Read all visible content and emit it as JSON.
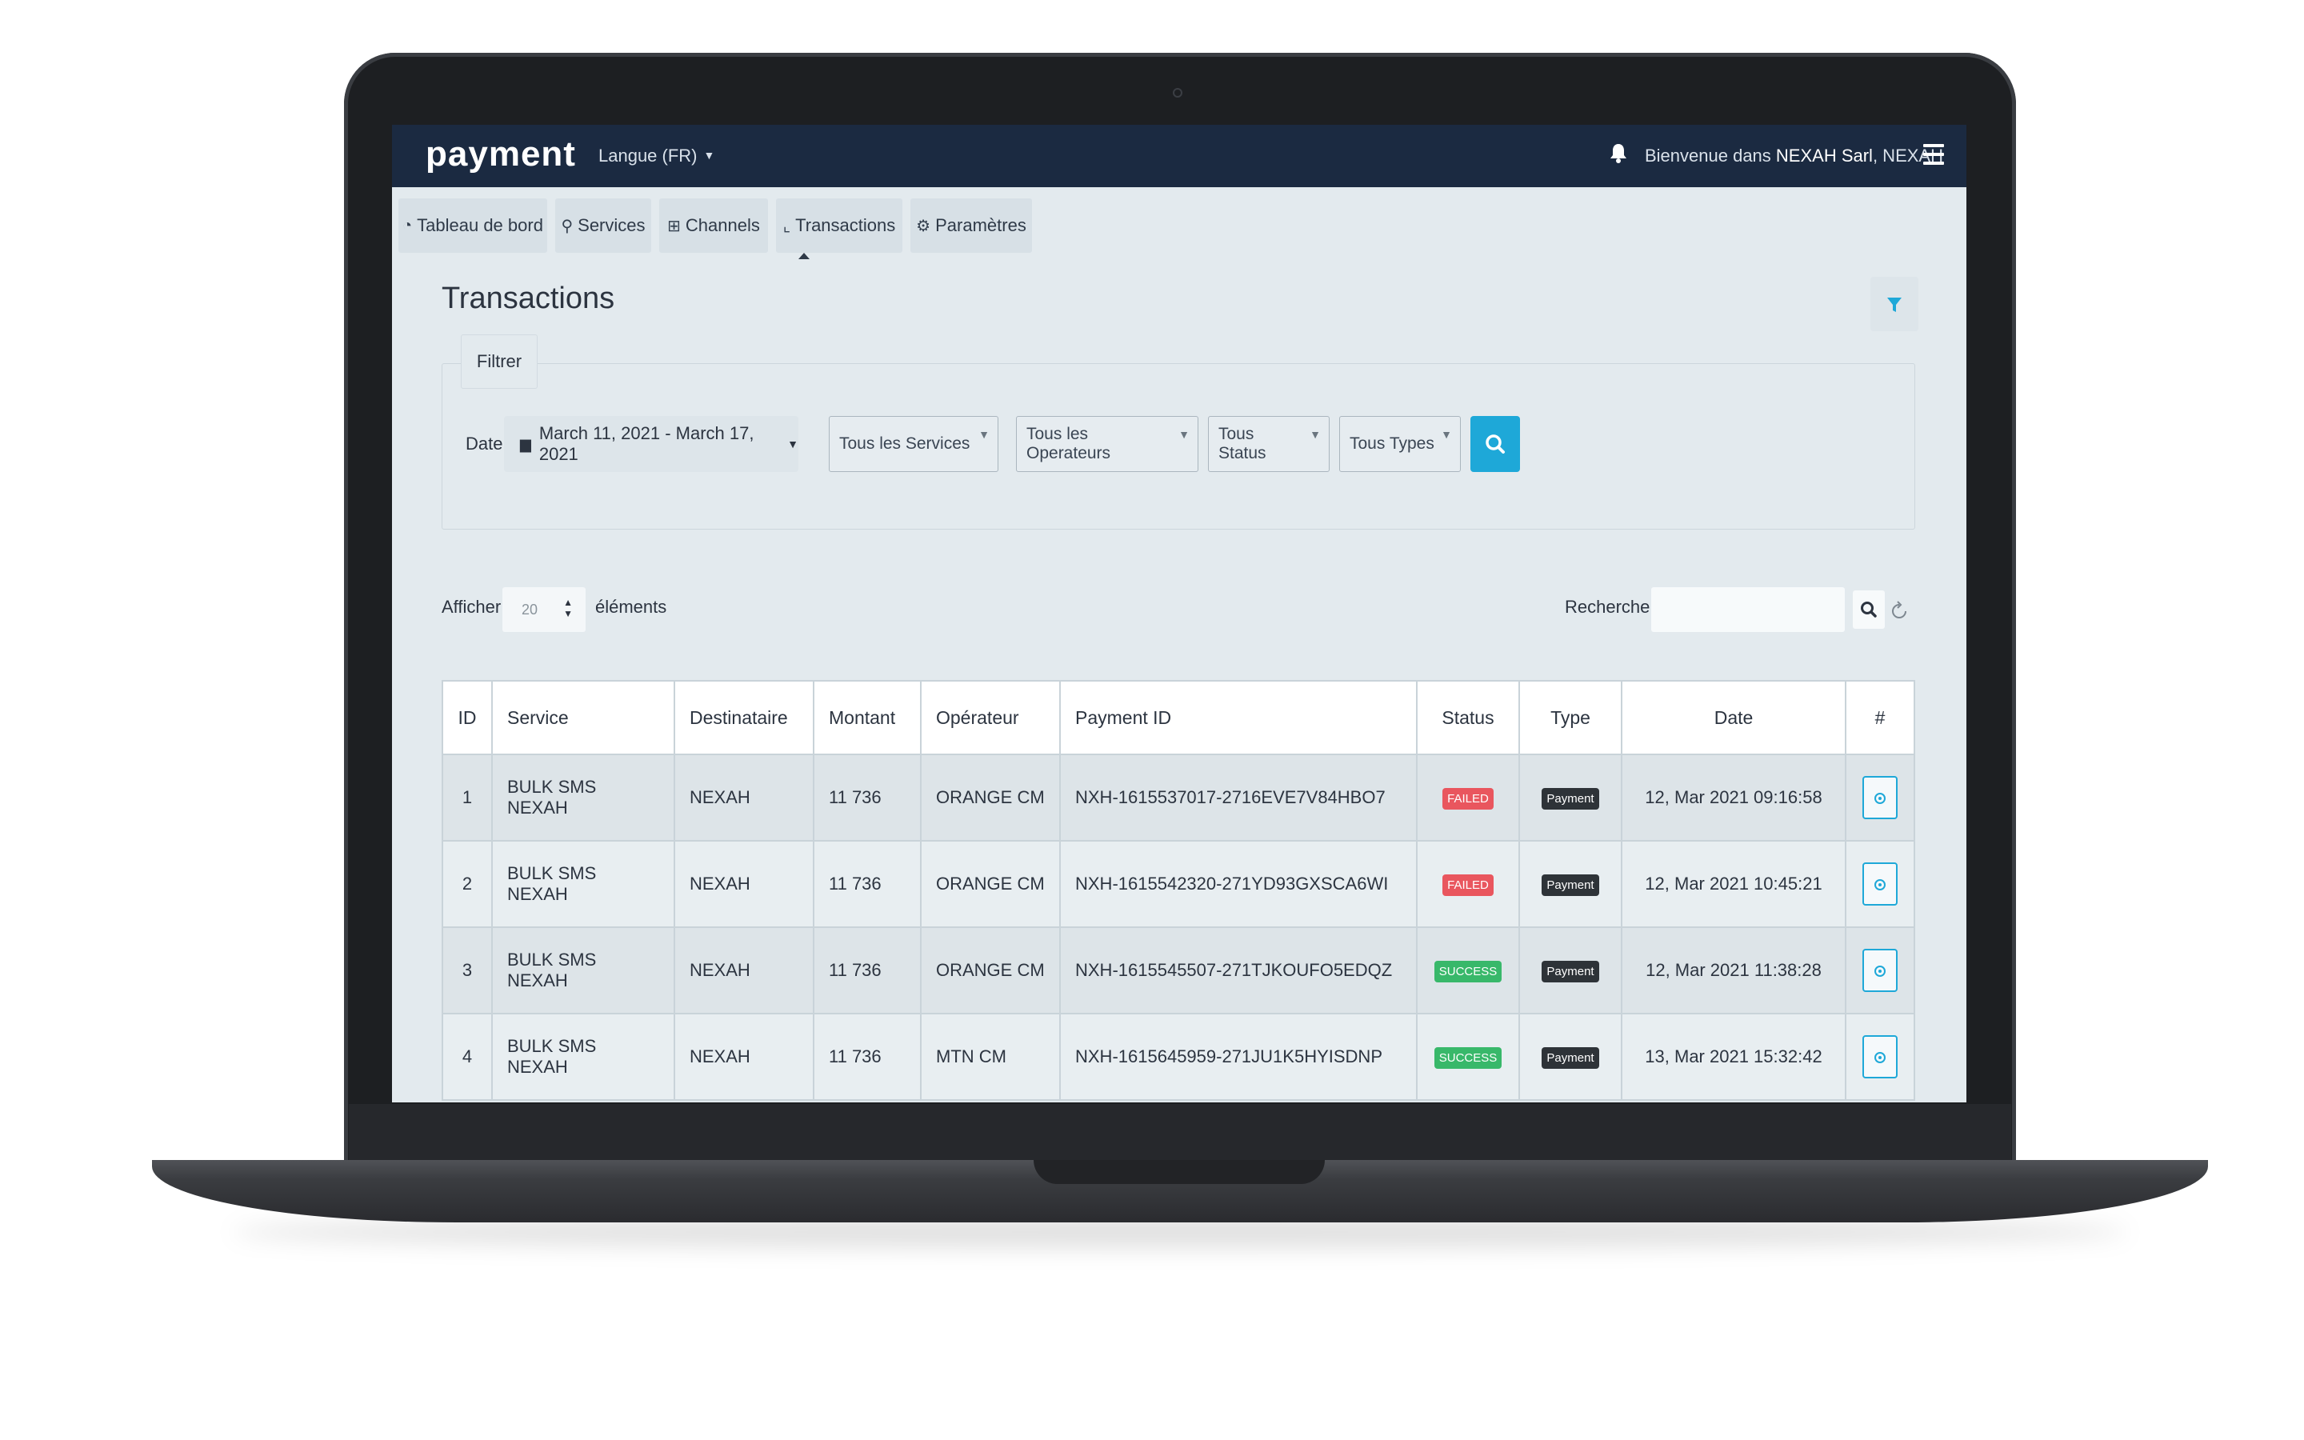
{
  "brand": {
    "logo": "payment"
  },
  "topbar": {
    "language": "Langue (FR)",
    "welcome_prefix": "Bienvenue dans ",
    "welcome_company": "NEXAH Sarl",
    "welcome_suffix": ", NEXAH"
  },
  "nav": {
    "tabs": [
      {
        "label": "Tableau de bord",
        "icon": "dashboard-icon"
      },
      {
        "label": "Services",
        "icon": "wrench-icon"
      },
      {
        "label": "Channels",
        "icon": "sitemap-icon"
      },
      {
        "label": "Transactions",
        "icon": "line-chart-icon",
        "active": true
      },
      {
        "label": "Paramètres",
        "icon": "gear-icon"
      }
    ]
  },
  "page": {
    "title": "Transactions"
  },
  "filter": {
    "legend": "Filtrer",
    "date_label": "Date",
    "date_range": "March 11, 2021 - March 17, 2021",
    "services": "Tous les Services",
    "operators": "Tous les Operateurs",
    "status": "Tous Status",
    "types": "Tous Types"
  },
  "list": {
    "show_label": "Afficher",
    "page_size": "20",
    "elements_label": "éléments",
    "search_label": "Recherche"
  },
  "table": {
    "headers": [
      "ID",
      "Service",
      "Destinataire",
      "Montant",
      "Opérateur",
      "Payment ID",
      "Status",
      "Type",
      "Date",
      "#"
    ],
    "rows": [
      {
        "id": "1",
        "service": "BULK SMS NEXAH",
        "recipient": "NEXAH",
        "amount": "11 736",
        "operator": "ORANGE CM",
        "payment_id": "NXH-1615537017-2716EVE7V84HBO7",
        "status": "FAILED",
        "type": "Payment",
        "date": "12, Mar 2021 09:16:58"
      },
      {
        "id": "2",
        "service": "BULK SMS NEXAH",
        "recipient": "NEXAH",
        "amount": "11 736",
        "operator": "ORANGE CM",
        "payment_id": "NXH-1615542320-271YD93GXSCA6WI",
        "status": "FAILED",
        "type": "Payment",
        "date": "12, Mar 2021 10:45:21"
      },
      {
        "id": "3",
        "service": "BULK SMS NEXAH",
        "recipient": "NEXAH",
        "amount": "11 736",
        "operator": "ORANGE CM",
        "payment_id": "NXH-1615545507-271TJKOUFO5EDQZ",
        "status": "SUCCESS",
        "type": "Payment",
        "date": "12, Mar 2021 11:38:28"
      },
      {
        "id": "4",
        "service": "BULK SMS NEXAH",
        "recipient": "NEXAH",
        "amount": "11 736",
        "operator": "MTN CM",
        "payment_id": "NXH-1615645959-271JU1K5HYISDNP",
        "status": "SUCCESS",
        "type": "Payment",
        "date": "13, Mar 2021 15:32:42"
      }
    ]
  },
  "colors": {
    "topbar": "#1b2a41",
    "accent": "#1ea8d8",
    "failed": "#e9565e",
    "success": "#38b86a"
  }
}
